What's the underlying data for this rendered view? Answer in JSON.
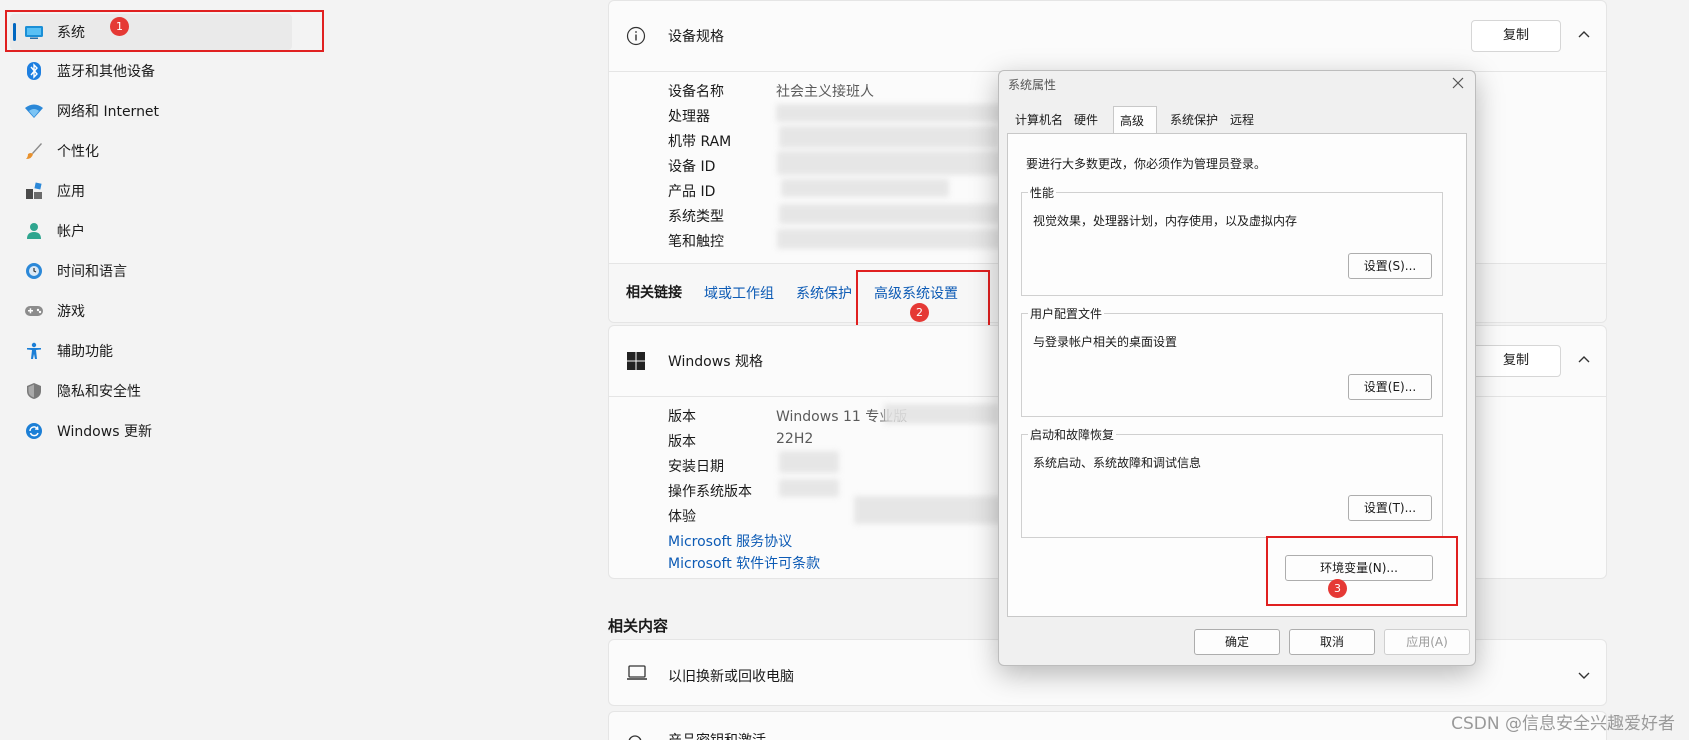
{
  "sidebar": {
    "items": [
      {
        "label": "系统",
        "icon": "system-icon"
      },
      {
        "label": "蓝牙和其他设备",
        "icon": "bluetooth-icon"
      },
      {
        "label": "网络和 Internet",
        "icon": "wifi-icon"
      },
      {
        "label": "个性化",
        "icon": "brush-icon"
      },
      {
        "label": "应用",
        "icon": "apps-icon"
      },
      {
        "label": "帐户",
        "icon": "account-icon"
      },
      {
        "label": "时间和语言",
        "icon": "clock-globe-icon"
      },
      {
        "label": "游戏",
        "icon": "gamepad-icon"
      },
      {
        "label": "辅助功能",
        "icon": "accessibility-icon"
      },
      {
        "label": "隐私和安全性",
        "icon": "shield-icon"
      },
      {
        "label": "Windows 更新",
        "icon": "update-icon"
      }
    ]
  },
  "badges": {
    "one": "1",
    "two": "2",
    "three": "3"
  },
  "device_specs": {
    "title": "设备规格",
    "copy_label": "复制",
    "rows": [
      {
        "label": "设备名称",
        "value": "社会主义接班人"
      },
      {
        "label": "处理器",
        "value": ""
      },
      {
        "label": "机带 RAM",
        "value": ""
      },
      {
        "label": "设备 ID",
        "value": ""
      },
      {
        "label": "产品 ID",
        "value": ""
      },
      {
        "label": "系统类型",
        "value": ""
      },
      {
        "label": "笔和触控",
        "value": ""
      }
    ]
  },
  "related_links": {
    "label": "相关链接",
    "links": [
      "域或工作组",
      "系统保护",
      "高级系统设置"
    ]
  },
  "windows_specs": {
    "title": "Windows 规格",
    "copy_label": "复制",
    "rows": [
      {
        "label": "版本",
        "value": "Windows 11 专业版"
      },
      {
        "label": "版本",
        "value": "22H2"
      },
      {
        "label": "安装日期",
        "value": ""
      },
      {
        "label": "操作系统版本",
        "value": ""
      },
      {
        "label": "体验",
        "value": ""
      }
    ],
    "links": [
      "Microsoft 服务协议",
      "Microsoft 软件许可条款"
    ]
  },
  "related_content": {
    "title": "相关内容",
    "items": [
      "以旧换新或回收电脑",
      "产品密钥和激活"
    ]
  },
  "dialog": {
    "title": "系统属性",
    "tabs": [
      "计算机名",
      "硬件",
      "高级",
      "系统保护",
      "远程"
    ],
    "active_tab": "高级",
    "admin_note": "要进行大多数更改，你必须作为管理员登录。",
    "groups": [
      {
        "label": "性能",
        "desc": "视觉效果，处理器计划，内存使用，以及虚拟内存",
        "button": "设置(S)..."
      },
      {
        "label": "用户配置文件",
        "desc": "与登录帐户相关的桌面设置",
        "button": "设置(E)..."
      },
      {
        "label": "启动和故障恢复",
        "desc": "系统启动、系统故障和调试信息",
        "button": "设置(T)..."
      }
    ],
    "env_button": "环境变量(N)...",
    "ok": "确定",
    "cancel": "取消",
    "apply": "应用(A)"
  },
  "watermark": "CSDN @信息安全兴趣爱好者",
  "colors": {
    "accent": "#0067c0",
    "link": "#0d5bb5",
    "annotation": "#e02020"
  }
}
